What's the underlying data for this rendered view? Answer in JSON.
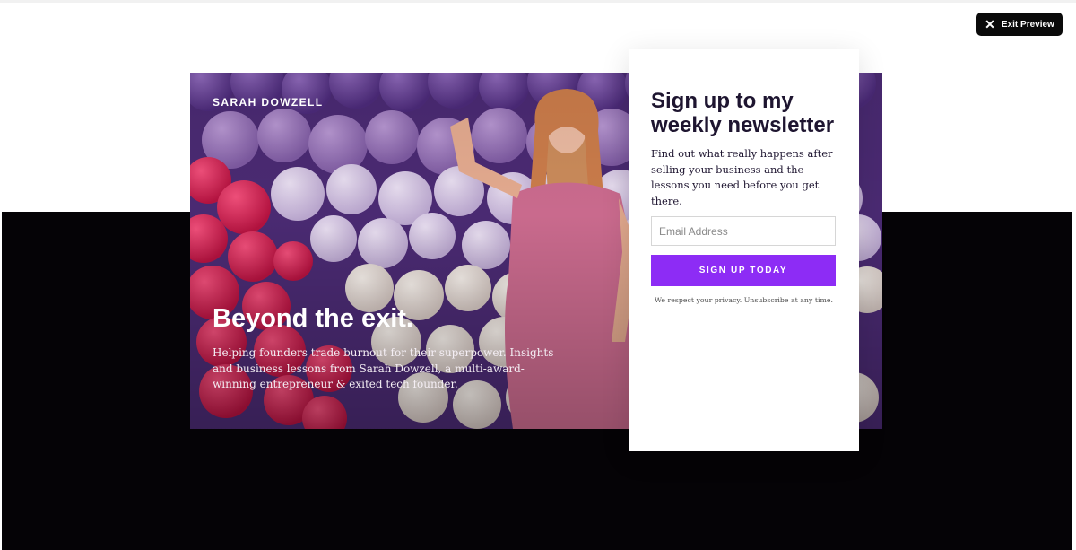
{
  "preview": {
    "exit_label": "Exit Preview",
    "exit_icon": "close-icon"
  },
  "hero": {
    "brand": "SARAH DOWZELL",
    "title": "Beyond the exit.",
    "subtitle": "Helping founders trade burnout for their superpower. Insights and business lessons from Sarah Dowzell, a multi-award-winning entrepreneur & exited tech founder."
  },
  "signup": {
    "title": "Sign up to my weekly newsletter",
    "description": "Find out what really happens after selling your business and the lessons you need before you get there.",
    "email_placeholder": "Email Address",
    "button_label": "SIGN UP TODAY",
    "privacy_note": "We respect your privacy. Unsubscribe at any time."
  },
  "colors": {
    "accent": "#8d2cf5",
    "page_dark": "#050306",
    "text_dark": "#1e1530"
  }
}
